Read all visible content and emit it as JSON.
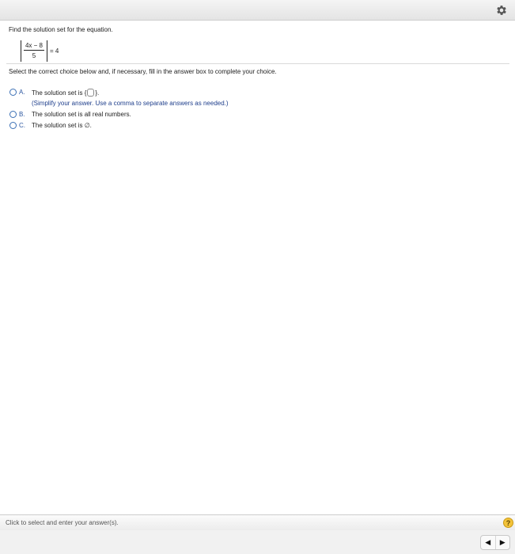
{
  "question": {
    "prompt": "Find the solution set for the equation.",
    "equation": {
      "numerator": "4x − 8",
      "denominator": "5",
      "rhs": "= 4"
    }
  },
  "instructions": "Select the correct choice below and, if necessary, fill in the answer box to complete your choice.",
  "options": [
    {
      "letter": "A.",
      "text_before": "The solution set is {",
      "text_after": "}.",
      "hint": "(Simplify your answer. Use a comma to separate answers as needed.)"
    },
    {
      "letter": "B.",
      "text": "The solution set is all real numbers."
    },
    {
      "letter": "C.",
      "text": "The solution set is ∅."
    }
  ],
  "status_bar": {
    "text": "Click to select and enter your answer(s).",
    "help_label": "?"
  },
  "nav": {
    "prev": "◀",
    "next": "▶"
  },
  "icons": {
    "settings": "gear-icon"
  },
  "colors": {
    "accent": "#2d57a0",
    "hint": "#1f3f8c",
    "help_badge": "#f3c33a"
  }
}
